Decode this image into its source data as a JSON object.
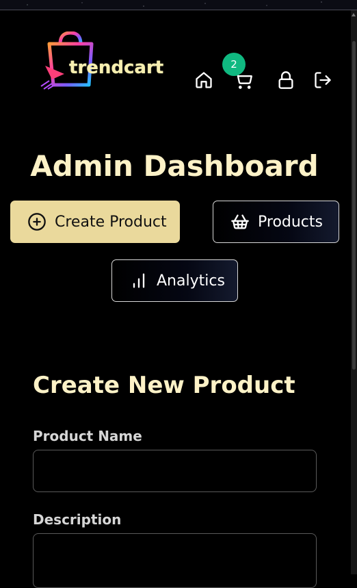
{
  "header": {
    "logo_text": "trendcart",
    "nav": [
      {
        "name": "home-icon"
      },
      {
        "name": "cart-icon"
      },
      {
        "name": "lock-icon"
      },
      {
        "name": "logout-icon"
      }
    ],
    "cart_count": "2"
  },
  "page": {
    "title": "Admin Dashboard"
  },
  "tabs": [
    {
      "label": "Create Product",
      "icon": "plus-circle-icon",
      "active": true
    },
    {
      "label": "Products",
      "icon": "basket-icon",
      "active": false
    },
    {
      "label": "Analytics",
      "icon": "bar-chart-icon",
      "active": false
    }
  ],
  "form": {
    "title": "Create New Product",
    "fields": [
      {
        "label": "Product Name",
        "value": "",
        "placeholder": ""
      },
      {
        "label": "Description",
        "value": "",
        "placeholder": ""
      }
    ]
  },
  "colors": {
    "accent": "#ead99c",
    "title": "#fdf2c7",
    "badge": "#10b981",
    "background": "#000000"
  }
}
